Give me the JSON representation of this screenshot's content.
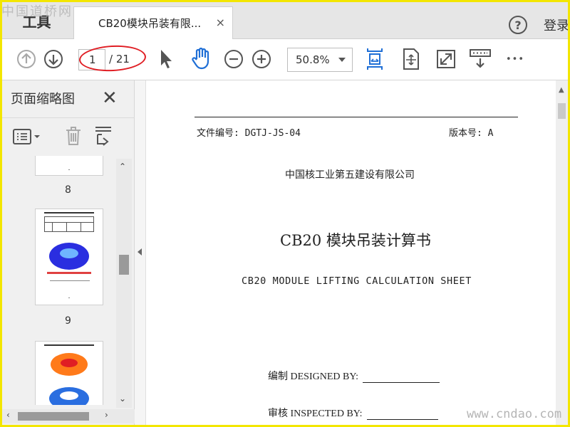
{
  "watermark_top": "中国道桥网",
  "watermark_bottom": "www.cndao.com",
  "tabbar": {
    "tools_label": "工具",
    "doc_tab_title": "CB20模块吊装有限...",
    "close_glyph": "×",
    "help_glyph": "?",
    "login_label": "登录"
  },
  "toolbar": {
    "current_page": "1",
    "total_pages": "/ 21",
    "zoom": "50.8%",
    "more_glyph": "•••"
  },
  "side_panel": {
    "title": "页面缩略图",
    "close_glyph": "✕",
    "pages": [
      {
        "label": "8"
      },
      {
        "label": "9"
      },
      {
        "label": ""
      }
    ]
  },
  "document": {
    "doc_number": "文件编号:  DGTJ-JS-04",
    "version": "版本号: A",
    "company": "中国核工业第五建设有限公司",
    "title_cn": "CB20 模块吊装计算书",
    "title_en": "CB20 MODULE LIFTING CALCULATION SHEET",
    "designed_by": "编制 DESIGNED BY:",
    "inspected_by": "审核 INSPECTED BY:"
  },
  "colors": {
    "accent_blue": "#1f6fd6",
    "annotation_red": "#e01e24",
    "frame_yellow": "#f3e600"
  }
}
